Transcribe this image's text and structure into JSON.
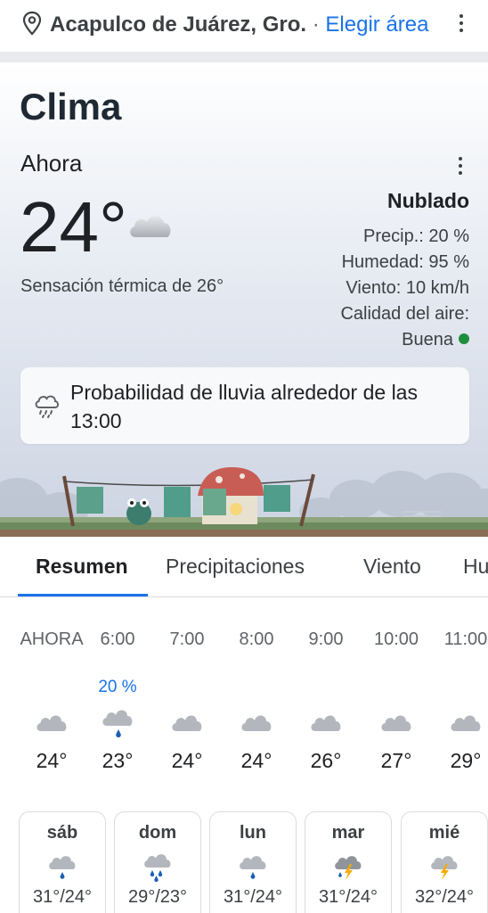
{
  "top_bar": {
    "location": "Acapulco de Juárez, Gro.",
    "separator": " · ",
    "change_area": "Elegir área",
    "icon": "location-pin-icon"
  },
  "card": {
    "title": "Clima",
    "now_label": "Ahora",
    "temperature": "24°",
    "condition_icon": "cloud-icon",
    "feels_like": "Sensación térmica de 26°",
    "condition": "Nublado",
    "precip": "Precip.: 20 %",
    "humidity": "Humedad: 95 %",
    "wind": "Viento: 10 km/h",
    "air_quality_label": "Calidad del aire:",
    "air_quality_value": "Buena",
    "air_quality_color": "#1e8e3e"
  },
  "alert": {
    "icon": "rain-cloud-icon",
    "text": "Probabilidad de lluvia alrededor de las 13:00"
  },
  "tabs": [
    {
      "label": "Resumen",
      "active": true
    },
    {
      "label": "Precipitaciones",
      "active": false
    },
    {
      "label": "Viento",
      "active": false
    },
    {
      "label": "Humedad",
      "active": false
    }
  ],
  "hourly": [
    {
      "time": "AHORA",
      "precip": "",
      "icon": "cloud-icon",
      "temp": "24°"
    },
    {
      "time": "6:00",
      "precip": "20 %",
      "icon": "cloud-rain-icon",
      "temp": "23°"
    },
    {
      "time": "7:00",
      "precip": "",
      "icon": "cloud-icon",
      "temp": "24°"
    },
    {
      "time": "8:00",
      "precip": "",
      "icon": "cloud-icon",
      "temp": "24°"
    },
    {
      "time": "9:00",
      "precip": "",
      "icon": "cloud-icon",
      "temp": "26°"
    },
    {
      "time": "10:00",
      "precip": "",
      "icon": "cloud-icon",
      "temp": "27°"
    },
    {
      "time": "11:00",
      "precip": "",
      "icon": "cloud-icon",
      "temp": "29°"
    }
  ],
  "daily": [
    {
      "day": "sáb",
      "icon": "cloud-rain-icon",
      "range": "31°/24°"
    },
    {
      "day": "dom",
      "icon": "cloud-heavy-rain-icon",
      "range": "29°/23°"
    },
    {
      "day": "lun",
      "icon": "cloud-rain-icon",
      "range": "31°/24°"
    },
    {
      "day": "mar",
      "icon": "thunderstorm-icon",
      "range": "31°/24°"
    },
    {
      "day": "mié",
      "icon": "thunderstorm-icon",
      "range": "32°/24°"
    }
  ],
  "colors": {
    "accent": "#1a73e8",
    "text": "#202124"
  }
}
